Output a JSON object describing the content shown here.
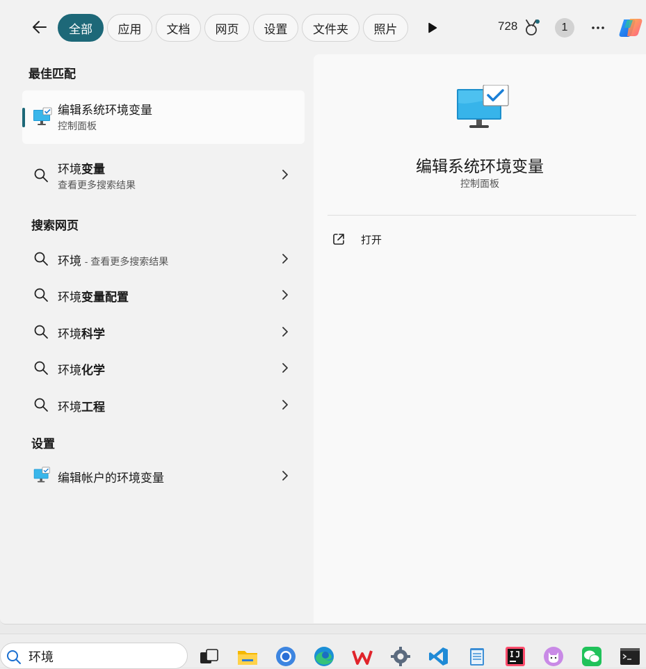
{
  "tabs": [
    "全部",
    "应用",
    "文档",
    "网页",
    "设置",
    "文件夹",
    "照片"
  ],
  "header": {
    "points": "728",
    "badge": "1"
  },
  "best_match": {
    "heading": "最佳匹配",
    "title": "编辑系统环境变量",
    "subtitle": "控制面板"
  },
  "env_row": {
    "plain": "环境",
    "bold": "变量",
    "subtitle": "查看更多搜索结果"
  },
  "web": {
    "heading": "搜索网页",
    "items": [
      {
        "plain": "环境",
        "bold": "",
        "hint": "- 查看更多搜索结果"
      },
      {
        "plain": "环境",
        "bold": "变量配置",
        "hint": ""
      },
      {
        "plain": "环境",
        "bold": "科学",
        "hint": ""
      },
      {
        "plain": "环境",
        "bold": "化学",
        "hint": ""
      },
      {
        "plain": "环境",
        "bold": "工程",
        "hint": ""
      }
    ]
  },
  "settings": {
    "heading": "设置",
    "item": "编辑帐户的环境变量"
  },
  "detail": {
    "title": "编辑系统环境变量",
    "subtitle": "控制面板",
    "open_label": "打开"
  },
  "search": {
    "value": "环境"
  },
  "taskbar_apps": [
    "task-view-icon",
    "file-explorer-icon",
    "chrome-icon",
    "edge-icon",
    "wps-icon",
    "settings-icon",
    "vscode-icon",
    "notepad-icon",
    "intellij-icon",
    "cat-app-icon",
    "wechat-icon",
    "terminal-icon"
  ],
  "colors": {
    "accent": "#1d6878",
    "panel_bg": "#f2f2f2",
    "detail_bg": "#f9f9f9"
  }
}
